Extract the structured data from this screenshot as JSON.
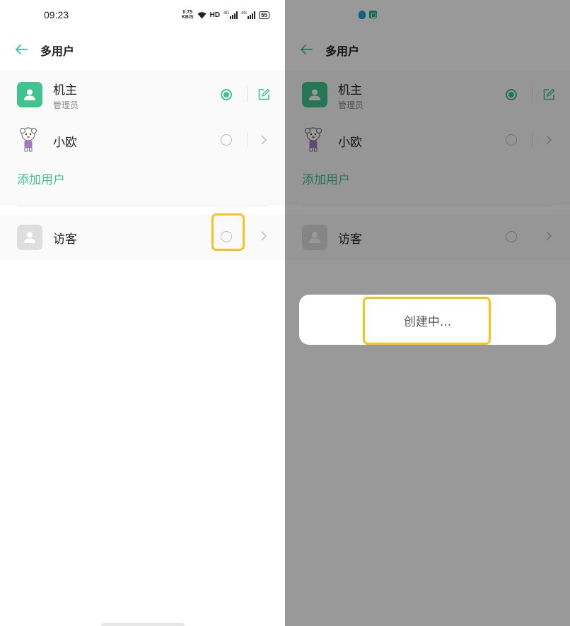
{
  "status_bar": {
    "time": "09:23",
    "net_speed_value": "0.75",
    "net_speed_unit": "KB/S",
    "hd_label": "HD",
    "signal_label_1": "4G",
    "signal_label_2": "4G",
    "battery": "55"
  },
  "header": {
    "title": "多用户"
  },
  "users": [
    {
      "name": "机主",
      "role": "管理员",
      "selected": true
    },
    {
      "name": "小欧",
      "role": "",
      "selected": false
    }
  ],
  "add_user_label": "添加用户",
  "guest": {
    "name": "访客",
    "selected": false
  },
  "dialog": {
    "text": "创建中..."
  },
  "colors": {
    "accent": "#3fc48f",
    "highlight": "#f5c31c",
    "overlay": "rgba(0,0,0,0.40)"
  },
  "icons": [
    "back-arrow-icon",
    "person-icon",
    "edit-icon",
    "chevron-right-icon",
    "wifi-icon",
    "signal-icon",
    "battery-icon",
    "qq-notification-icon",
    "message-notification-icon"
  ]
}
